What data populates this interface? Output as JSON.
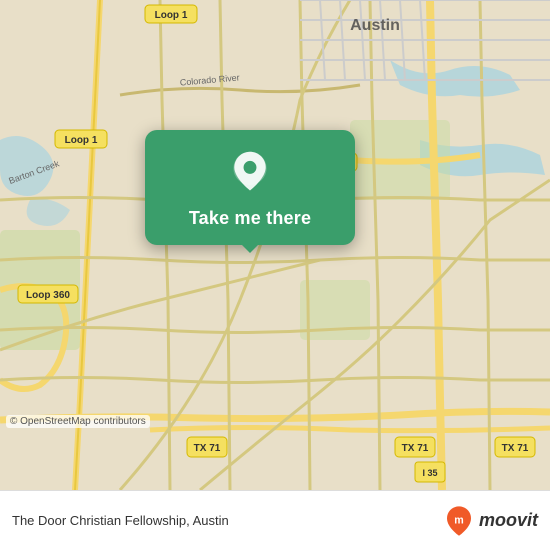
{
  "map": {
    "background_color": "#e8dfc8",
    "copyright": "© OpenStreetMap contributors"
  },
  "popup": {
    "button_label": "Take me there",
    "pin_color": "#ffffff"
  },
  "bottom_bar": {
    "location_text": "The Door Christian Fellowship, Austin",
    "moovit_label": "moovit"
  }
}
